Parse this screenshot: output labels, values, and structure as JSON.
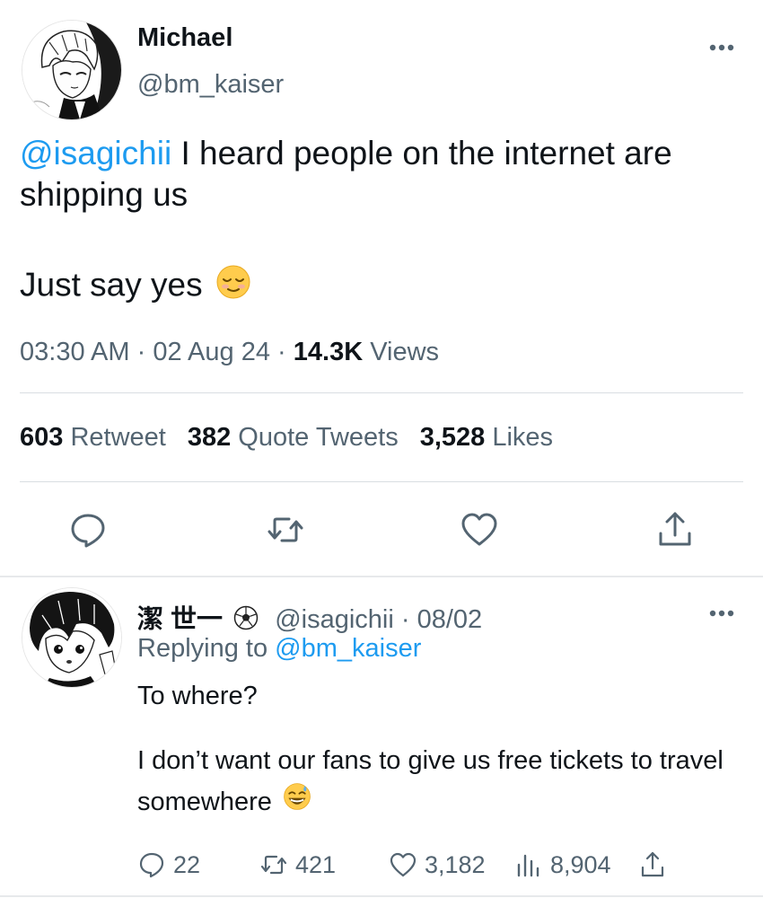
{
  "main_tweet": {
    "author": {
      "display_name": "Michael",
      "handle": "@bm_kaiser"
    },
    "text": {
      "mention": "@isagichii",
      "line1": " I heard people on the internet are shipping us",
      "line2": "Just say yes",
      "line2_emoji": "relieved-face-emoji"
    },
    "meta": {
      "time": "03:30 AM",
      "separator": "·",
      "date": "02 Aug 24",
      "views_count": "14.3K",
      "views_label": "Views"
    },
    "stats": {
      "retweets_count": "603",
      "retweets_label": "Retweet",
      "quotes_count": "382",
      "quotes_label": "Quote Tweets",
      "likes_count": "3,528",
      "likes_label": "Likes"
    },
    "icons": [
      "reply-icon",
      "retweet-icon",
      "like-icon",
      "share-icon",
      "more-icon"
    ]
  },
  "reply_tweet": {
    "author": {
      "display_name": "潔 世一",
      "badge_icon": "soccer-ball-icon",
      "handle": "@isagichii",
      "date": "08/02"
    },
    "replying_prefix": "Replying to",
    "replying_to": "@bm_kaiser",
    "text": {
      "para1": "To where?",
      "para2": "I don’t want our fans to give us free tickets to travel somewhere",
      "para2_emoji": "grinning-face-with-sweat-emoji"
    },
    "actions": {
      "replies": "22",
      "retweets": "421",
      "likes": "3,182",
      "views": "8,904"
    }
  },
  "colors": {
    "accent": "#1d9bf0",
    "secondary_text": "#536471",
    "primary_text": "#0f1419",
    "divider": "#d9dee2"
  }
}
